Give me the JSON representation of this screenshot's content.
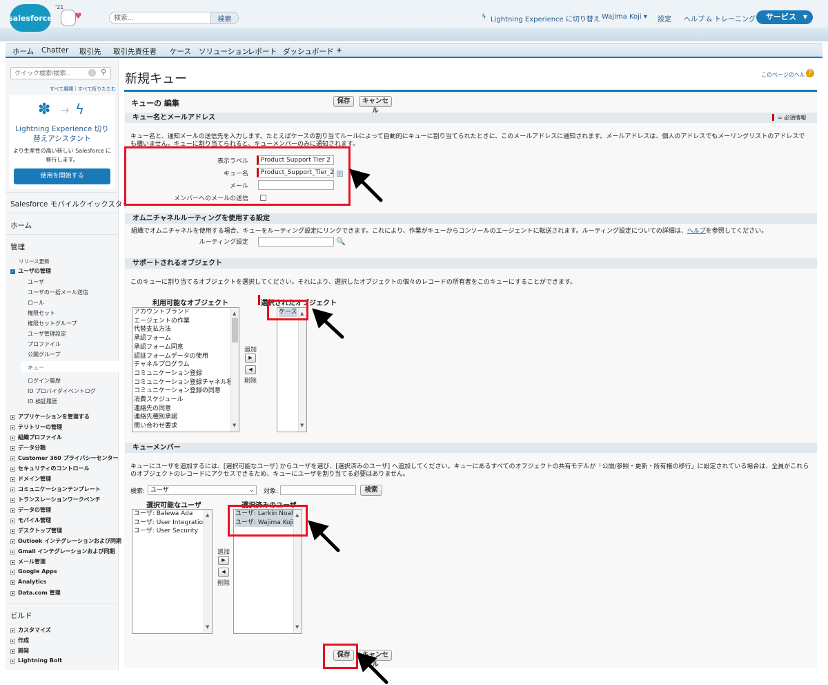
{
  "header": {
    "logo_text": "salesforce",
    "mascot_year": "'21",
    "search_placeholder": "検索...",
    "search_button": "検索",
    "lightning_switch": "Lightning Experience に切り替え",
    "user_name": "Wajima Koji",
    "settings": "設定",
    "help_training": "ヘルプ & トレーニング",
    "app_menu": "サービス"
  },
  "tabs": [
    "ホーム",
    "Chatter",
    "取引先",
    "取引先責任者",
    "ケース",
    "ソリューション",
    "レポート",
    "ダッシュボード",
    "+"
  ],
  "sidebar": {
    "quick_search_placeholder": "クイック検索/検索...",
    "expand_all": "すべて展開",
    "collapse_all": "すべて折りたたむ",
    "assistant_title": "Lightning Experience 切り替えアシスタント",
    "assistant_text": "より生産性の高い新しい Salesforce に移行します。",
    "assistant_button": "使用を開始する",
    "mobile_quickstart": "Salesforce モバイルクイックスタート",
    "home": "ホーム",
    "admin": "管理",
    "release_updates": "リリース更新",
    "user_mgmt": "ユーザの管理",
    "user_mgmt_items": [
      "ユーザ",
      "ユーザの一括メール送信",
      "ロール",
      "権限セット",
      "権限セットグループ",
      "ユーザ管理設定",
      "プロファイル",
      "公開グループ",
      "キュー",
      "ログイン履歴",
      "ID プロバイダイベントログ",
      "ID 検証履歴"
    ],
    "categories": [
      "アプリケーションを管理する",
      "テリトリーの管理",
      "組織プロファイル",
      "データ分類",
      "Customer 360 プライバシーセンター",
      "セキュリティのコントロール",
      "ドメイン管理",
      "コミュニケーションテンプレート",
      "トランスレーションワークベンチ",
      "データの管理",
      "モバイル管理",
      "デスクトップ管理",
      "Outlook インテグレーションおよび同期",
      "Gmail インテグレーションおよび同期",
      "メール管理",
      "Google Apps",
      "Analytics",
      "Data.com 管理"
    ],
    "build": "ビルド",
    "build_items": [
      "カスタマイズ",
      "作成",
      "開発",
      "Lightning Bolt"
    ]
  },
  "main": {
    "title": "新規キュー",
    "page_help": "このページのヘルプ",
    "edit_title": "キューの 編集",
    "save": "保存",
    "cancel": "キャンセル",
    "required_info": "= 必須情報",
    "section1_title": "キュー名とメールアドレス",
    "section1_desc": "キュー名と、通知メールの送信先を入力します。たとえばケースの割り当てルールによって自動的にキューに割り当てられたときに、このメールアドレスに通知されます。メールアドレスは、個人のアドレスでもメーリングリストのアドレスでも構いません。キューに割り当てられると、キューメンバーのみに通知されます。",
    "label_label": "表示ラベル",
    "label_value": "Product Support Tier 2",
    "name_label": "キュー名",
    "name_value": "Product_Support_Tier_2",
    "email_label": "メール",
    "email_value": "",
    "send_email_label": "メンバーへのメールの送信",
    "section2_title": "オムニチャネルルーティングを使用する設定",
    "section2_desc_pre": "組織でオムニチャネルを使用する場合、キューをルーティング設定にリンクできます。これにより、作業がキューからコンソールのエージェントに転送されます。ルーティング設定についての詳細は、",
    "section2_help": "ヘルプ",
    "section2_desc_post": "を参照してください。",
    "routing_label": "ルーティング設定",
    "section3_title": "サポートされるオブジェクト",
    "section3_desc": "このキューに割り当てるオブジェクトを選択してください。それにより、選択したオブジェクトの個々のレコードの所有者をこのキューにすることができます。",
    "available_objects_title": "利用可能なオブジェクト",
    "selected_objects_title": "選択されたオブジェクト",
    "available_objects": [
      "アカウントブランド",
      "エージェントの作業",
      "代替支払方法",
      "承認フォーム",
      "承認フォーム同意",
      "認証フォームデータの使用",
      "チャネルプログラム",
      "コミュニケーション登録",
      "コミュニケーション登録チャネル種別",
      "コミュニケーション登録の同意",
      "消費スケジュール",
      "連絡先の同意",
      "連絡先種別承諾",
      "問い合わせ要求"
    ],
    "selected_objects": [
      "ケース"
    ],
    "add": "追加",
    "remove": "削除",
    "section4_title": "キューメンバー",
    "section4_desc": "キューにユーザを追加するには、[選択可能なユーザ] からユーザを選び、[選択済みのユーザ] へ追加してください。キューにあるすべてのオブジェクトの共有モデルが「公開/参照・更新・所有権の移行」に設定されている場合は、全員がこれらのオブジェクトのレコードにアクセスできるため、キューにユーザを割り当てる必要はありません。",
    "search_label": "検索:",
    "search_type": "ユーザ",
    "target_label": "対象:",
    "search_button": "検索",
    "available_users_title": "選択可能なユーザ",
    "selected_users_title": "選択済みのユーザ",
    "available_users": [
      "ユーザ: Balewa Ada",
      "ユーザ: User Integration",
      "ユーザ: User Security"
    ],
    "selected_users": [
      "ユーザ: Larkin Noah",
      "ユーザ: Wajima Koji"
    ]
  },
  "colors": {
    "accent": "#1a7ab8",
    "highlight": "#e81123"
  }
}
